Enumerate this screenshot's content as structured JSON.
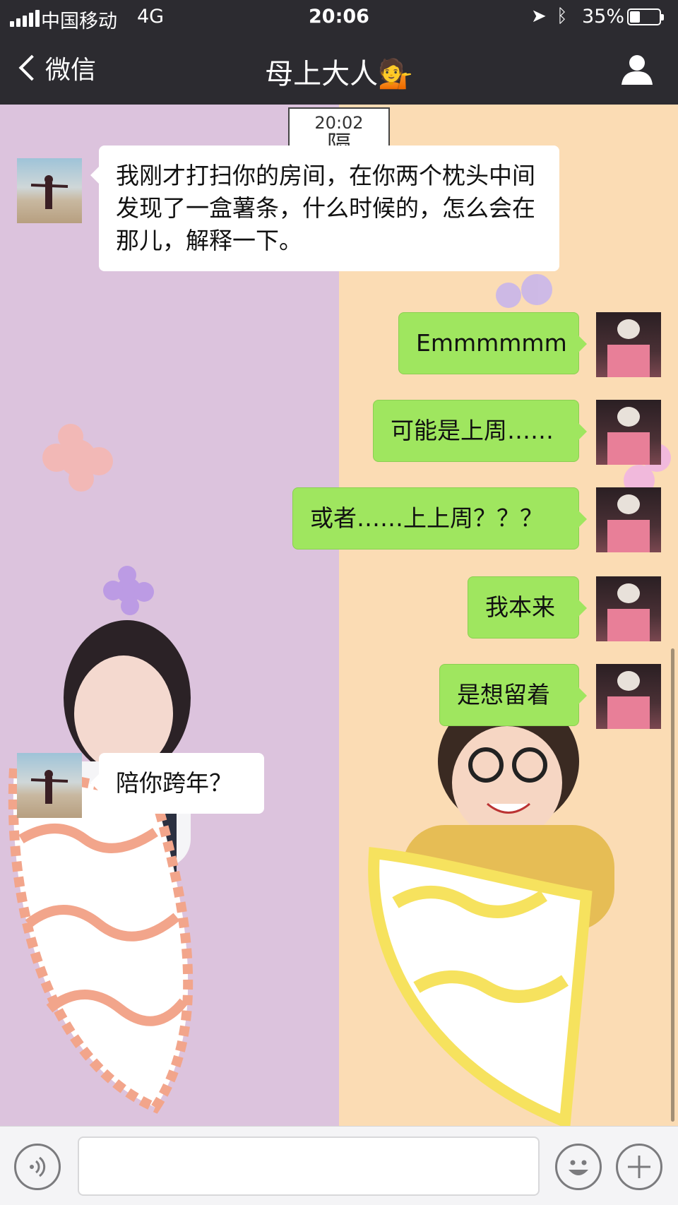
{
  "status_bar": {
    "carrier": "中国移动",
    "network": "4G",
    "time": "20:06",
    "battery_percent": "35%",
    "battery_level": 0.35,
    "location_icon": "location-arrow-icon",
    "bluetooth_icon": "bluetooth-icon"
  },
  "nav": {
    "back_label": "微信",
    "title": "母上大人💁",
    "profile_icon": "person-icon"
  },
  "chat": {
    "timestamp": "20:02",
    "timestamp_sticker_glyph": "隔",
    "background_left": "#dcc3dd",
    "background_right": "#fbdcb4",
    "messages": [
      {
        "from": "mom",
        "text": "我刚才打扫你的房间，在你两个枕头中间发现了一盒薯条，什么时候的，怎么会在那儿，解释一下。"
      },
      {
        "from": "me",
        "text": "Emmmmmm"
      },
      {
        "from": "me",
        "text": "可能是上周……"
      },
      {
        "from": "me",
        "text": "或者……上上周？？？"
      },
      {
        "from": "me",
        "text": "我本来"
      },
      {
        "from": "me",
        "text": "是想留着"
      },
      {
        "from": "mom",
        "text": "陪你跨年？"
      }
    ]
  },
  "input_bar": {
    "voice_icon": "voice-icon",
    "emoji_icon": "emoji-icon",
    "plus_icon": "plus-icon"
  },
  "colors": {
    "nav_bg": "#2c2b30",
    "bubble_out": "#9fe65f",
    "bubble_in": "#ffffff"
  }
}
